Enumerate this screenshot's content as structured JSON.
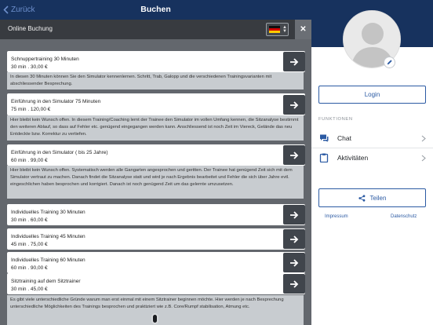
{
  "header": {
    "back_label": "Zurück",
    "title": "Buchen"
  },
  "subheader": {
    "label": "Online Buchung",
    "language": "de"
  },
  "items": [
    {
      "name": "Schnuppertraining 30 Minuten",
      "meta": "30 min . 30,00 €",
      "description": "In diesen 30 Minuten können Sie den Simulator kennenlernen. Schritt, Trab, Galopp und die verschiedenen Trainingsvarianten mit abschliessender Besprechung."
    },
    {
      "name": "Einführung in den Simulator 75 Minuten",
      "meta": "75 min . 120,00 €",
      "description": "Hier bleibt kein Wunsch offen. In diesem Training/Coaching lernt der Trainee den Simulator im vollen Umfang kennen, die Sitzanalyse bestimmt den weiteren Ablauf, so dass auf Fehler etc. genügend eingegangen werden kann. Anschliessend ist noch Zeit im Viereck, Gelände das neu Entdeckte bzw. Korrektur zu vertiefen."
    },
    {
      "name": "Einführung in den Simulator ( bis 25 Jahre)",
      "meta": "60 min . 99,00 €",
      "description": "Hier bleibt kein Wunsch offen. Systematisch werden alle Gangarten angesprochen und geritten. Der Trainee hat genügend Zeit sich mit dem Simulator vertraut zu machen. Danach findet die Sitzanalyse statt und wird je nach Ergebnis bearbeitet und Fehler die sich über Jahre evtl. eingeschlichen haben besprochen und korrigiert. Danach ist noch genügend Zeit um das gelernte umzusetzen."
    },
    {
      "name": "Individuelles Training 30 Minuten",
      "meta": "30 min . 60,00 €"
    },
    {
      "name": "Individuelles Training 45 Minuten",
      "meta": "45 min . 75,00 €"
    },
    {
      "name": "Individuelles Training 60 Minuten",
      "meta": "60 min . 90,00 €"
    },
    {
      "name": "Sitztraining auf dem Sitztrainer",
      "meta": "30 min . 45,00 €",
      "description": "Es gibt viele unterschiedliche Gründe warum man erst einmal mit einem Sitztrainer beginnen möchte. Hier werden je nach Besprechung unterschiedliche Möglichkeiten des Trainings besprochen und praktiziert wie z.B. Core/Rumpf stabilisation, Atmung etc."
    }
  ],
  "sidebar": {
    "login_label": "Login",
    "section_label": "FUNKTIONEN",
    "menu": [
      {
        "label": "Chat",
        "icon": "chat-icon"
      },
      {
        "label": "Aktivitäten",
        "icon": "clipboard-icon"
      }
    ],
    "share_label": "Teilen",
    "impressum_label": "Impressum",
    "privacy_label": "Datenschutz"
  },
  "colors": {
    "nav_blue": "#17325e",
    "accent_blue": "#2b5aa3",
    "button_dark": "#40454c"
  }
}
